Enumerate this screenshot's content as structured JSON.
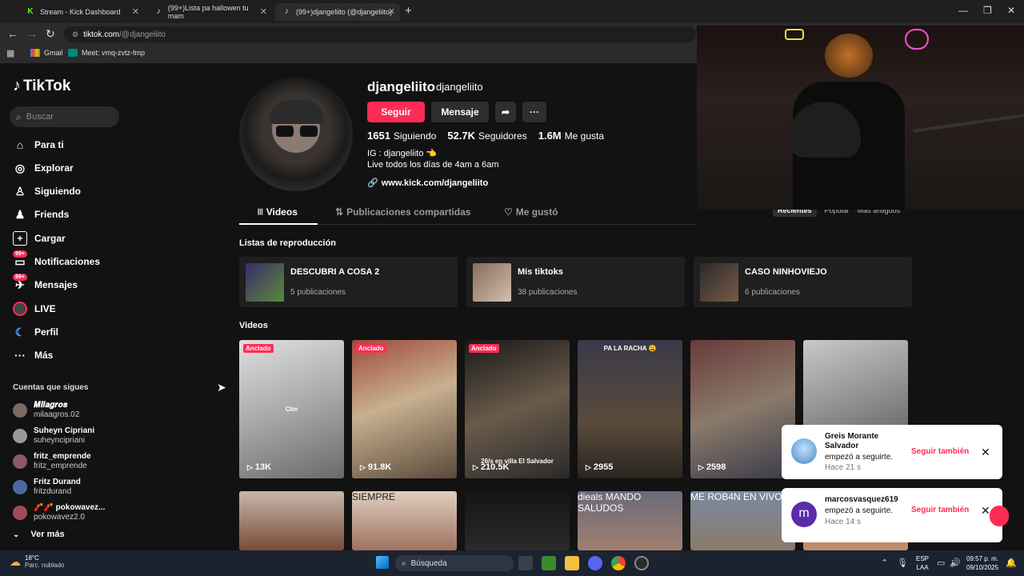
{
  "browser": {
    "tabs": [
      {
        "title": "Stream - Kick Dashboard",
        "favicon": "kick-icon",
        "active": false
      },
      {
        "title": "(99+)Lista pa hallowen tu mam",
        "favicon": "tiktok-icon",
        "active": false
      },
      {
        "title": "(99+)djangeliito (@djangeliito)",
        "favicon": "tiktok-icon",
        "active": true
      }
    ],
    "url_host": "tiktok.com",
    "url_path": "/@djangeliito",
    "bookmarks": [
      {
        "label": "Gmail",
        "icon": "gmail-icon"
      },
      {
        "label": "Meet: vmq-zvtz-fmp",
        "icon": "meet-icon"
      }
    ]
  },
  "sidebar": {
    "logo": "TikTok",
    "search_placeholder": "Buscar",
    "nav": [
      {
        "label": "Para ti",
        "icon": "home-icon"
      },
      {
        "label": "Explorar",
        "icon": "compass-icon"
      },
      {
        "label": "Siguiendo",
        "icon": "following-icon"
      },
      {
        "label": "Friends",
        "icon": "friends-icon"
      },
      {
        "label": "Cargar",
        "icon": "upload-icon"
      },
      {
        "label": "Notificaciones",
        "icon": "inbox-icon",
        "badge": "99+"
      },
      {
        "label": "Mensajes",
        "icon": "message-icon",
        "badge": "99+"
      },
      {
        "label": "LIVE",
        "icon": "live-icon"
      },
      {
        "label": "Perfil",
        "icon": "profile-icon"
      },
      {
        "label": "Más",
        "icon": "more-icon"
      }
    ],
    "following_title": "Cuentas que sigues",
    "following": [
      {
        "name": "𝑴𝒊𝒍𝒂𝒈𝒓𝒐𝒔",
        "handle": "milaagros.02"
      },
      {
        "name": "Suheyn Cipriani",
        "handle": "suheyncipriani"
      },
      {
        "name": "fritz_emprende",
        "handle": "fritz_emprende"
      },
      {
        "name": "Fritz Durand",
        "handle": "fritzdurand"
      },
      {
        "name": "🧨🧨 pokowavez...",
        "handle": "pokowavez2.0"
      }
    ],
    "see_more": "Ver más"
  },
  "profile": {
    "username": "djangeliito",
    "nickname": "djangeliito",
    "follow_label": "Seguir",
    "message_label": "Mensaje",
    "stats": [
      {
        "value": "1651",
        "label": "Siguiendo"
      },
      {
        "value": "52.7K",
        "label": "Seguidores"
      },
      {
        "value": "1.6M",
        "label": "Me gusta"
      }
    ],
    "bio_line1": "IG : djangeliito 👈",
    "bio_line2": "Live todos los días de 4am a 6am",
    "link": "www.kick.com/djangeliito",
    "tabs": [
      "Videos",
      "Publicaciones compartidas",
      "Me gustó"
    ],
    "sort_options": [
      "Recientes",
      "Popular",
      "Más antiguos"
    ]
  },
  "playlists_title": "Listas de reproducción",
  "playlists": [
    {
      "title": "DESCUBRI A COSA 2",
      "count": "5 publicaciones"
    },
    {
      "title": "Mis tiktoks",
      "count": "38 publicaciones"
    },
    {
      "title": "CASO NINHOVIEJO",
      "count": "6 publicaciones"
    }
  ],
  "videos_title": "Videos",
  "videos": [
    {
      "views": "13K",
      "pinned": "Anclado",
      "caption": "Ctm"
    },
    {
      "views": "91.8K",
      "pinned": "Anclado",
      "caption": ""
    },
    {
      "views": "210.5K",
      "pinned": "Anclado",
      "caption": "26/s en villa El Salvador"
    },
    {
      "views": "2955",
      "pinned": "",
      "caption": "PA LA RACHA 😩"
    },
    {
      "views": "2598",
      "pinned": "",
      "caption": ""
    },
    {
      "views": "",
      "pinned": "",
      "caption": ""
    }
  ],
  "videos_row2_captions": [
    "",
    "SIEMPRE",
    "",
    "dieals MANDO SALUDOS",
    "ME ROB4N EN VIVO",
    ""
  ],
  "notifications": [
    {
      "name": "Greis Morante Salvador",
      "text": "empezó a seguirte.",
      "time": "Hace 21 s",
      "action": "Seguir también"
    },
    {
      "name": "marcosvasquez619",
      "text": "empezó a seguirte.",
      "time": "Hace 14 s",
      "action": "Seguir también",
      "initial": "m"
    }
  ],
  "taskbar": {
    "temp": "18°C",
    "weather": "Parc. nublado",
    "search": "Búsqueda",
    "lang1": "ESP",
    "lang2": "LAA",
    "time": "09:57 p. m.",
    "date": "09/10/2025"
  },
  "colors": {
    "accent": "#fe2c55",
    "bg": "#121212"
  }
}
